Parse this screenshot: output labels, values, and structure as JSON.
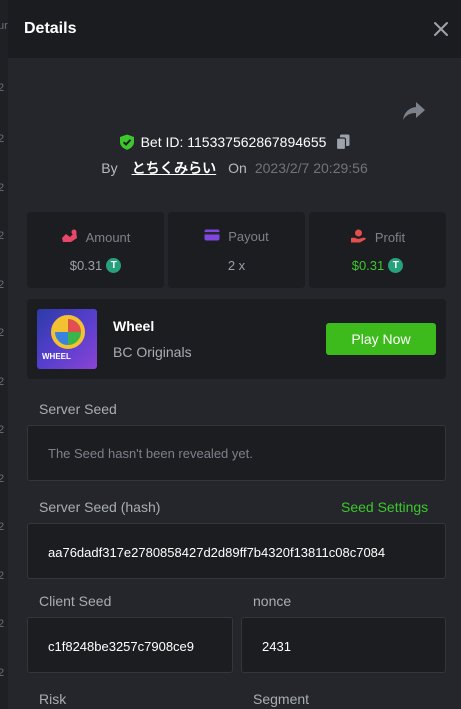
{
  "background_strip": [
    "ur",
    "2",
    "2",
    "2",
    "2",
    "2",
    "2",
    "2",
    "2",
    "2",
    "2",
    "2",
    "2",
    "2"
  ],
  "header": {
    "title": "Details",
    "close_icon": "close-icon"
  },
  "share_icon": "share-icon",
  "bet": {
    "id_label": "Bet ID: 115337562867894655",
    "shield_icon": "shield-check-icon",
    "copy_icon": "copy-icon"
  },
  "byline": {
    "by": "By",
    "user": "とちくみらい",
    "on": "On",
    "date": "2023/2/7 20:29:56"
  },
  "stats": [
    {
      "label": "Amount",
      "value": "$0.31",
      "icon": "amount-icon",
      "value_color": "#9aa0a8"
    },
    {
      "label": "Payout",
      "value": "2 x",
      "icon": "payout-card-icon",
      "value_color": "#9aa0a8"
    },
    {
      "label": "Profit",
      "value": "$0.31",
      "icon": "profit-icon",
      "value_color": "#3cc82c"
    }
  ],
  "currency_symbol": "T",
  "game": {
    "thumb_label": "WHEEL",
    "name": "Wheel",
    "provider": "BC Originals",
    "play_label": "Play Now"
  },
  "server_seed": {
    "label": "Server Seed",
    "value": "The Seed hasn't been revealed yet."
  },
  "server_seed_hash": {
    "label": "Server Seed (hash)",
    "settings_link": "Seed Settings",
    "value": "aa76dadf317e2780858427d2d89ff7b4320f13811c08c7084"
  },
  "client_seed": {
    "label": "Client Seed",
    "value": "c1f8248be3257c7908ce9"
  },
  "nonce": {
    "label": "nonce",
    "value": "2431"
  },
  "risk": {
    "label": "Risk"
  },
  "segment": {
    "label": "Segment"
  },
  "colors": {
    "accent_green": "#3ebb1c",
    "panel_bg": "#24262b",
    "card_bg": "#1c1d21",
    "header_bg": "#1b1c1f",
    "tether": "#26a17b"
  }
}
